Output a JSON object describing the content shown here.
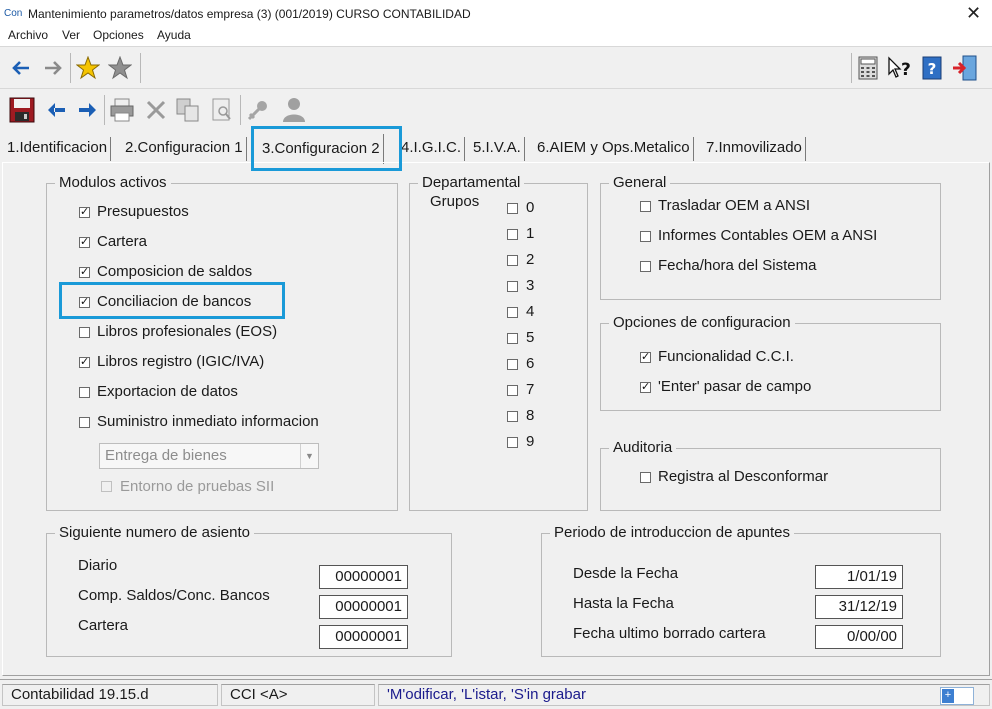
{
  "window": {
    "app_icon": "Con",
    "title": "Mantenimiento parametros/datos empresa   (3)       (001/2019) CURSO CONTABILIDAD",
    "close_icon": "close-icon"
  },
  "menu": [
    "Archivo",
    "Ver",
    "Opciones",
    "Ayuda"
  ],
  "tabs": [
    {
      "label": "1.Identificacion"
    },
    {
      "label": "2.Configuracion 1"
    },
    {
      "label": "3.Configuracion 2"
    },
    {
      "label": "4.I.G.I.C."
    },
    {
      "label": "5.I.V.A."
    },
    {
      "label": "6.AIEM y Ops.Metalico"
    },
    {
      "label": "7.Inmovilizado"
    }
  ],
  "modulos": {
    "title": "Modulos activos",
    "items": [
      {
        "label": "Presupuestos",
        "checked": true
      },
      {
        "label": "Cartera",
        "checked": true
      },
      {
        "label": "Composicion de saldos",
        "checked": true
      },
      {
        "label": "Conciliacion de bancos",
        "checked": true
      },
      {
        "label": "Libros profesionales (EOS)",
        "checked": false
      },
      {
        "label": "Libros registro (IGIC/IVA)",
        "checked": true
      },
      {
        "label": "Exportacion de datos",
        "checked": false
      },
      {
        "label": "Suministro inmediato informacion",
        "checked": false
      }
    ],
    "select_value": "Entrega de bienes",
    "entorno_label": "Entorno de pruebas SII"
  },
  "departamental": {
    "title": "Departamental",
    "grupos_label": "Grupos",
    "items": [
      "0",
      "1",
      "2",
      "3",
      "4",
      "5",
      "6",
      "7",
      "8",
      "9"
    ]
  },
  "general": {
    "title": "General",
    "items": [
      {
        "label": "Trasladar OEM a ANSI",
        "checked": false
      },
      {
        "label": "Informes Contables OEM a ANSI",
        "checked": false
      },
      {
        "label": "Fecha/hora del Sistema",
        "checked": false
      }
    ]
  },
  "opciones": {
    "title": "Opciones de configuracion",
    "items": [
      {
        "label": "Funcionalidad C.C.I.",
        "checked": true
      },
      {
        "label": "'Enter' pasar de campo",
        "checked": true
      }
    ]
  },
  "auditoria": {
    "title": "Auditoria",
    "items": [
      {
        "label": "Registra al Desconformar",
        "checked": false
      }
    ]
  },
  "siguiente": {
    "title": "Siguiente numero de asiento",
    "rows": [
      {
        "label": "Diario",
        "value": "00000001"
      },
      {
        "label": "Comp. Saldos/Conc. Bancos",
        "value": "00000001"
      },
      {
        "label": "Cartera",
        "value": "00000001"
      }
    ]
  },
  "periodo": {
    "title": "Periodo de introduccion de apuntes",
    "rows": [
      {
        "label": "Desde la Fecha",
        "value": "1/01/19"
      },
      {
        "label": "Hasta la Fecha",
        "value": "31/12/19"
      },
      {
        "label": "Fecha ultimo borrado cartera",
        "value": "0/00/00"
      }
    ]
  },
  "status": {
    "version": "Contabilidad 19.15.d",
    "mode": "CCI <A>",
    "hint": "'M'odificar, 'L'istar, 'S'in grabar"
  },
  "colors": {
    "highlight": "#1a9ad8",
    "hint_text": "#1a1a8c",
    "back_arrow": "#1b5fb5"
  }
}
